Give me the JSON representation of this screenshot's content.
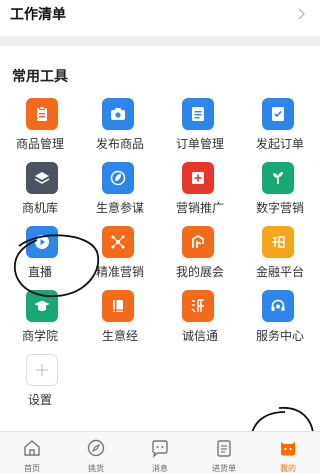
{
  "header": {
    "title": "工作清单"
  },
  "tools": {
    "section_title": "常用工具",
    "items": [
      {
        "label": "商品管理",
        "icon": "clipboard-icon",
        "color": "#f26a1b"
      },
      {
        "label": "发布商品",
        "icon": "camera-icon",
        "color": "#2f86e8"
      },
      {
        "label": "订单管理",
        "icon": "list-icon",
        "color": "#2f86e8"
      },
      {
        "label": "发起订单",
        "icon": "order-icon",
        "color": "#2f86e8"
      },
      {
        "label": "商机库",
        "icon": "layers-icon",
        "color": "#4c5463"
      },
      {
        "label": "生意参谋",
        "icon": "leaf-icon",
        "color": "#2f86e8"
      },
      {
        "label": "营销推广",
        "icon": "plus-card-icon",
        "color": "#e8362f"
      },
      {
        "label": "数字营销",
        "icon": "sprout-icon",
        "color": "#19a874"
      },
      {
        "label": "直播",
        "icon": "play-icon",
        "color": "#2f86e8"
      },
      {
        "label": "精准营销",
        "icon": "network-icon",
        "color": "#f26a1b"
      },
      {
        "label": "我的展会",
        "icon": "expo-icon",
        "color": "#f26a1b"
      },
      {
        "label": "金融平台",
        "icon": "finance-icon",
        "color": "#f3a51c"
      },
      {
        "label": "商学院",
        "icon": "graduation-cap-icon",
        "color": "#19a874"
      },
      {
        "label": "生意经",
        "icon": "book-icon",
        "color": "#f26a1b"
      },
      {
        "label": "诚信通",
        "icon": "chengxin-icon",
        "color": "#f26a1b"
      },
      {
        "label": "服务中心",
        "icon": "headset-icon",
        "color": "#2f86e8"
      },
      {
        "label": "设置",
        "icon": "add-icon",
        "color": "#ffffff"
      }
    ]
  },
  "tabbar": {
    "active_color": "#ff6a00",
    "items": [
      {
        "label": "首页",
        "icon": "home-icon"
      },
      {
        "label": "挑货",
        "icon": "compass-icon"
      },
      {
        "label": "消息",
        "icon": "chat-icon"
      },
      {
        "label": "进货单",
        "icon": "cart-list-icon"
      },
      {
        "label": "我的",
        "icon": "profile-icon"
      }
    ]
  }
}
